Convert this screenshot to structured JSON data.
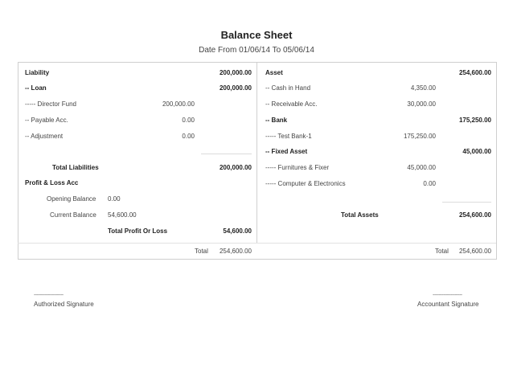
{
  "header": {
    "title": "Balance Sheet",
    "date_range": "Date From 01/06/14 To 05/06/14"
  },
  "liability": {
    "heading": "Liability",
    "heading_total": "200,000.00",
    "loan_label": "-- Loan",
    "loan_total": "200,000.00",
    "director_fund_label": "----- Director Fund",
    "director_fund_value": "200,000.00",
    "payable_label": "-- Payable Acc.",
    "payable_value": "0.00",
    "adjustment_label": "-- Adjustment",
    "adjustment_value": "0.00",
    "total_label": "Total Liabilities",
    "total_value": "200,000.00"
  },
  "profit_loss": {
    "heading": "Profit & Loss Acc",
    "opening_label": "Opening Balance",
    "opening_value": "0.00",
    "current_label": "Current Balance",
    "current_value": "54,600.00",
    "total_label": "Total Profit Or Loss",
    "total_value": "54,600.00"
  },
  "asset": {
    "heading": "Asset",
    "heading_total": "254,600.00",
    "cash_label": "-- Cash in Hand",
    "cash_value": "4,350.00",
    "receivable_label": "-- Receivable Acc.",
    "receivable_value": "30,000.00",
    "bank_label": "-- Bank",
    "bank_total": "175,250.00",
    "test_bank_label": "----- Test Bank-1",
    "test_bank_value": "175,250.00",
    "fixed_label": "-- Fixed Asset",
    "fixed_total": "45,000.00",
    "furniture_label": "----- Furnitures & Fixer",
    "furniture_value": "45,000.00",
    "computer_label": "----- Computer & Electronics",
    "computer_value": "0.00",
    "total_label": "Total Assets",
    "total_value": "254,600.00"
  },
  "footer_totals": {
    "left_label": "Total",
    "left_value": "254,600.00",
    "right_label": "Total",
    "right_value": "254,600.00"
  },
  "signatures": {
    "left_line": "--------------------",
    "left_label": "Authorized Signature",
    "right_line": "--------------------",
    "right_label": "Accountant Signature"
  }
}
